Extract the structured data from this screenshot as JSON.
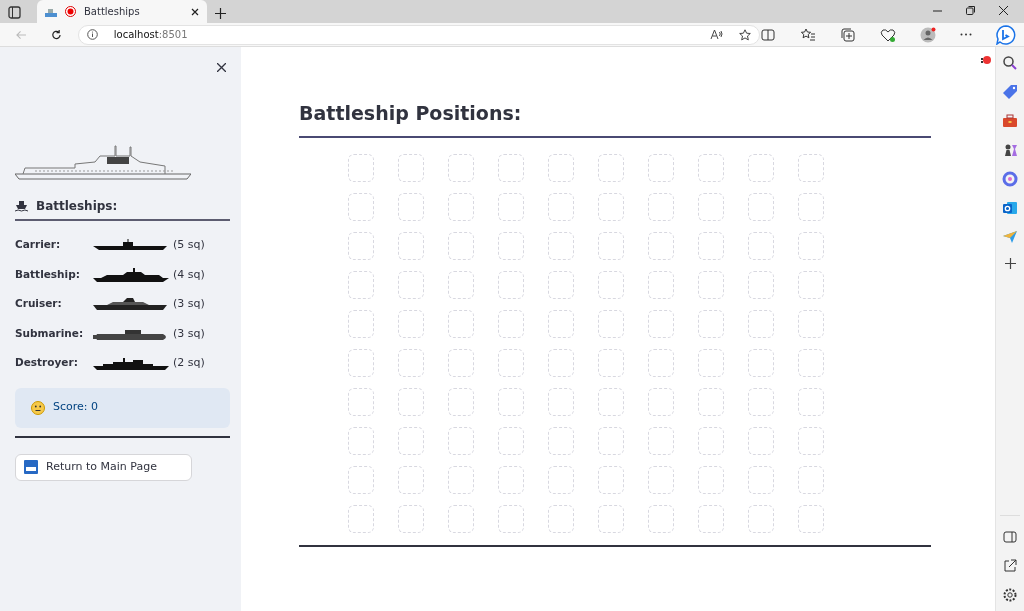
{
  "browser": {
    "tab_title": "Battleships",
    "url_host": "localhost",
    "url_port": ":8501"
  },
  "sidebar": {
    "heading": "Battleships:",
    "ships": [
      {
        "name": "Carrier:",
        "kind": "carrier",
        "size": "(5 sq)"
      },
      {
        "name": "Battleship:",
        "kind": "battleship",
        "size": "(4 sq)"
      },
      {
        "name": "Cruiser:",
        "kind": "cruiser",
        "size": "(3 sq)"
      },
      {
        "name": "Submarine:",
        "kind": "submarine",
        "size": "(3 sq)"
      },
      {
        "name": "Destroyer:",
        "kind": "destroyer",
        "size": "(2 sq)"
      }
    ],
    "score": "Score: 0",
    "return_button": "Return to Main Page"
  },
  "main": {
    "title": "Battleship Positions:",
    "grid": [
      [
        {
          "kind": "empty"
        },
        {
          "kind": "empty"
        },
        {
          "kind": "empty"
        },
        {
          "kind": "empty"
        },
        {
          "kind": "empty"
        },
        {
          "kind": "empty"
        },
        {
          "kind": "empty"
        },
        {
          "kind": "empty"
        },
        {
          "kind": "empty"
        },
        {
          "kind": "empty"
        }
      ],
      [
        {
          "kind": "empty"
        },
        {
          "kind": "empty"
        },
        {
          "kind": "empty"
        },
        {
          "kind": "empty"
        },
        {
          "kind": "empty"
        },
        {
          "kind": "empty"
        },
        {
          "kind": "empty"
        },
        {
          "kind": "empty"
        },
        {
          "kind": "empty"
        },
        {
          "kind": "empty"
        }
      ],
      [
        {
          "kind": "empty"
        },
        {
          "kind": "empty"
        },
        {
          "kind": "empty"
        },
        {
          "kind": "empty"
        },
        {
          "kind": "empty"
        },
        {
          "kind": "empty"
        },
        {
          "kind": "empty"
        },
        {
          "kind": "empty"
        },
        {
          "kind": "empty"
        },
        {
          "kind": "empty"
        }
      ],
      [
        {
          "kind": "empty"
        },
        {
          "kind": "empty"
        },
        {
          "kind": "empty"
        },
        {
          "kind": "empty"
        },
        {
          "kind": "empty"
        },
        {
          "kind": "empty"
        },
        {
          "kind": "empty"
        },
        {
          "kind": "empty"
        },
        {
          "kind": "empty"
        },
        {
          "kind": "empty"
        }
      ],
      [
        {
          "kind": "empty"
        },
        {
          "kind": "empty"
        },
        {
          "kind": "empty"
        },
        {
          "kind": "empty"
        },
        {
          "kind": "empty"
        },
        {
          "kind": "empty"
        },
        {
          "kind": "empty"
        },
        {
          "kind": "empty"
        },
        {
          "kind": "empty"
        },
        {
          "kind": "empty"
        }
      ],
      [
        {
          "kind": "empty"
        },
        {
          "kind": "empty"
        },
        {
          "kind": "empty"
        },
        {
          "kind": "empty"
        },
        {
          "kind": "empty"
        },
        {
          "kind": "empty"
        },
        {
          "kind": "empty"
        },
        {
          "kind": "empty"
        },
        {
          "kind": "empty"
        },
        {
          "kind": "empty"
        }
      ],
      [
        {
          "kind": "empty"
        },
        {
          "kind": "empty"
        },
        {
          "kind": "empty"
        },
        {
          "kind": "empty"
        },
        {
          "kind": "empty"
        },
        {
          "kind": "empty"
        },
        {
          "kind": "empty"
        },
        {
          "kind": "empty"
        },
        {
          "kind": "empty"
        },
        {
          "kind": "empty"
        }
      ],
      [
        {
          "kind": "empty"
        },
        {
          "kind": "empty"
        },
        {
          "kind": "empty"
        },
        {
          "kind": "empty"
        },
        {
          "kind": "empty"
        },
        {
          "kind": "empty"
        },
        {
          "kind": "empty"
        },
        {
          "kind": "empty"
        },
        {
          "kind": "empty"
        },
        {
          "kind": "empty"
        }
      ],
      [
        {
          "kind": "empty"
        },
        {
          "kind": "empty"
        },
        {
          "kind": "empty"
        },
        {
          "kind": "empty"
        },
        {
          "kind": "empty"
        },
        {
          "kind": "empty"
        },
        {
          "kind": "empty"
        },
        {
          "kind": "empty"
        },
        {
          "kind": "empty"
        },
        {
          "kind": "empty"
        }
      ],
      [
        {
          "kind": "empty"
        },
        {
          "kind": "empty"
        },
        {
          "kind": "empty"
        },
        {
          "kind": "empty"
        },
        {
          "kind": "empty"
        },
        {
          "kind": "empty"
        },
        {
          "kind": "empty"
        },
        {
          "kind": "empty"
        },
        {
          "kind": "empty"
        },
        {
          "kind": "empty"
        }
      ]
    ]
  }
}
